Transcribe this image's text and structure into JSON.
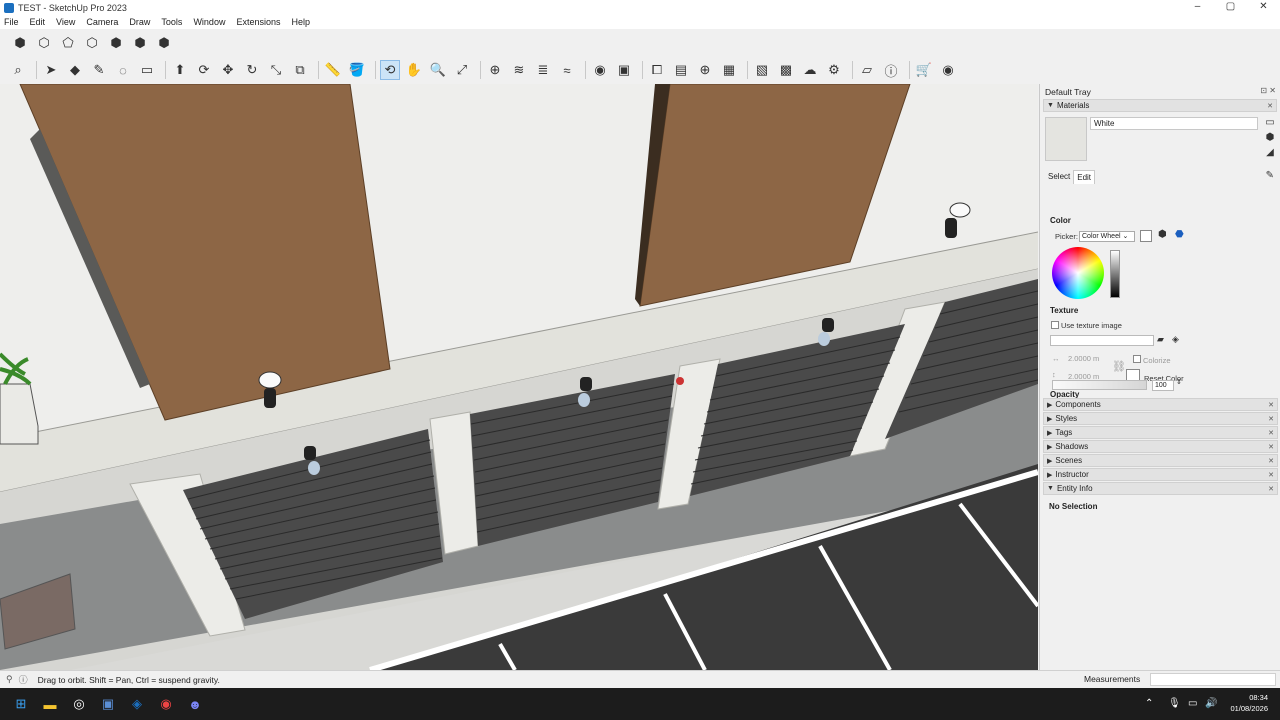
{
  "window": {
    "title": "TEST - SketchUp Pro 2023",
    "controls": [
      "–",
      "▢",
      "✕"
    ]
  },
  "menu": [
    "File",
    "Edit",
    "View",
    "Camera",
    "Draw",
    "Tools",
    "Window",
    "Extensions",
    "Help"
  ],
  "toolbar_views": [
    {
      "name": "iso-view-icon",
      "glyph": "⬢"
    },
    {
      "name": "top-view-icon",
      "glyph": "⬡"
    },
    {
      "name": "front-view-icon",
      "glyph": "⬠"
    },
    {
      "name": "right-view-icon",
      "glyph": "⬡"
    },
    {
      "name": "back-view-icon",
      "glyph": "⬢"
    },
    {
      "name": "left-view-icon",
      "glyph": "⬢"
    },
    {
      "name": "bottom-view-icon",
      "glyph": "⬢"
    }
  ],
  "toolbar_tools": [
    {
      "name": "search-icon",
      "glyph": "⌕"
    },
    {
      "name": "select-icon",
      "glyph": "➤"
    },
    {
      "name": "eraser-icon",
      "glyph": "◆"
    },
    {
      "name": "pencil-icon",
      "glyph": "✎"
    },
    {
      "name": "arc-icon",
      "glyph": "◌"
    },
    {
      "name": "shape-icon",
      "glyph": "▭"
    },
    {
      "name": "push-pull-icon",
      "glyph": "⬆"
    },
    {
      "name": "follow-me-icon",
      "glyph": "⟳"
    },
    {
      "name": "move-icon",
      "glyph": "✥"
    },
    {
      "name": "rotate-icon",
      "glyph": "↻"
    },
    {
      "name": "scale-icon",
      "glyph": "⤡"
    },
    {
      "name": "offset-icon",
      "glyph": "⧉"
    },
    {
      "name": "tape-measure-icon",
      "glyph": "📏"
    },
    {
      "name": "paint-bucket-icon",
      "glyph": "🪣"
    },
    {
      "name": "orbit-icon",
      "glyph": "⟲"
    },
    {
      "name": "pan-icon",
      "glyph": "✋"
    },
    {
      "name": "zoom-icon",
      "glyph": "🔍"
    },
    {
      "name": "zoom-extents-icon",
      "glyph": "⤢"
    },
    {
      "name": "section-plane-icon",
      "glyph": "⊕"
    },
    {
      "name": "layers-icon",
      "glyph": "≋"
    },
    {
      "name": "tags-icon",
      "glyph": "≣"
    },
    {
      "name": "styles-icon",
      "glyph": "≈"
    },
    {
      "name": "user-icon",
      "glyph": "◉"
    },
    {
      "name": "components-icon",
      "glyph": "▣"
    },
    {
      "name": "outliner-icon",
      "glyph": "⧠"
    },
    {
      "name": "scenes-icon",
      "glyph": "▤"
    },
    {
      "name": "add-location-icon",
      "glyph": "⊕"
    },
    {
      "name": "photo-icon",
      "glyph": "▦"
    },
    {
      "name": "texture-icon",
      "glyph": "▧"
    },
    {
      "name": "pattern-icon",
      "glyph": "▩"
    },
    {
      "name": "cloud-icon",
      "glyph": "☁"
    },
    {
      "name": "settings-icon",
      "glyph": "⚙"
    },
    {
      "name": "extension-icon",
      "glyph": "▱"
    },
    {
      "name": "info-icon",
      "glyph": "ⓘ"
    },
    {
      "name": "cart-icon",
      "glyph": "🛒"
    },
    {
      "name": "account-icon",
      "glyph": "◉"
    }
  ],
  "tray": {
    "title": "Default Tray",
    "materials": {
      "header": "Materials",
      "name": "White",
      "tab_select": "Select",
      "tab_edit": "Edit",
      "color_label": "Color",
      "picker_label": "Picker:",
      "picker_value": "Color Wheel",
      "texture_label": "Texture",
      "use_texture": "Use texture image",
      "width": "2.0000 m",
      "height": "2.0000 m",
      "colorize": "Colorize",
      "reset_color": "Reset Color",
      "opacity_label": "Opacity",
      "opacity_value": "100"
    },
    "panels": [
      "Components",
      "Styles",
      "Tags",
      "Shadows",
      "Scenes",
      "Instructor"
    ],
    "entity_info": {
      "header": "Entity Info",
      "value": "No Selection"
    }
  },
  "status": {
    "message": "Drag to orbit. Shift = Pan, Ctrl = suspend gravity.",
    "measurements_label": "Measurements"
  },
  "taskbar": {
    "time": "08:34",
    "date": "01/08/2026",
    "apps": [
      {
        "name": "windows-start-icon",
        "glyph": "⊞",
        "color": "#3aa0f0"
      },
      {
        "name": "file-explorer-icon",
        "glyph": "▬",
        "color": "#f4c430"
      },
      {
        "name": "github-icon",
        "glyph": "◎",
        "color": "#ffffff"
      },
      {
        "name": "app-icon",
        "glyph": "▣",
        "color": "#5b8fd6"
      },
      {
        "name": "sketchup-icon",
        "glyph": "◈",
        "color": "#1b6fbf"
      },
      {
        "name": "chrome-icon",
        "glyph": "◉",
        "color": "#e44"
      },
      {
        "name": "discord-icon",
        "glyph": "☻",
        "color": "#7a84f2"
      }
    ]
  },
  "colors": {
    "wall": "#e9e9e6",
    "brown_panel": "#8d6645",
    "shutter": "#4a4a4a",
    "road": "#3a3a3a"
  }
}
